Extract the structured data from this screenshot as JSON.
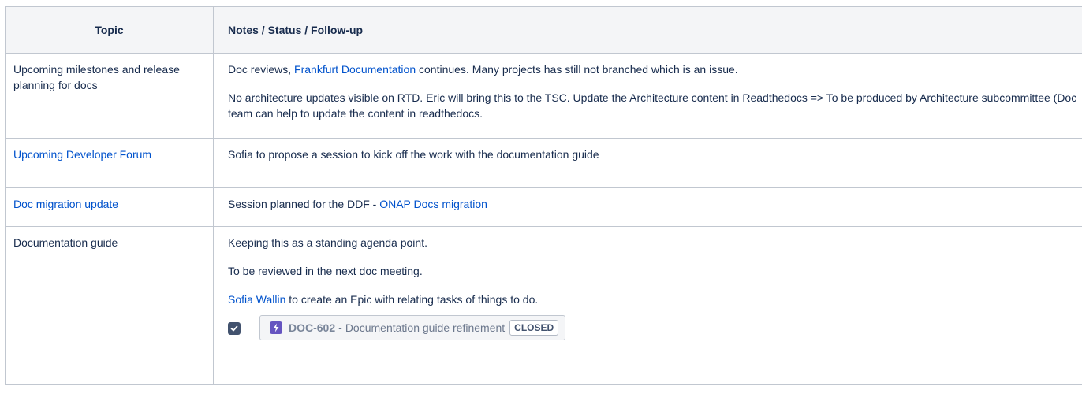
{
  "table": {
    "headers": {
      "topic": "Topic",
      "notes": "Notes / Status / Follow-up"
    },
    "rows": [
      {
        "topic": "Upcoming milestones and release planning for docs",
        "notes_p1_before": "Doc reviews, ",
        "notes_p1_link": "Frankfurt Documentation",
        "notes_p1_after": " continues. Many projects has still not branched which is an issue.",
        "notes_p2": "No architecture updates visible on RTD. Eric will bring this to the TSC. Update the Architecture content in Readthedocs => To be produced by Architecture subcommittee (Doc team can help to update the content in readthedocs."
      },
      {
        "topic_link": "Upcoming Developer Forum",
        "notes_p1": "Sofia to propose a session to kick off the work with the documentation guide"
      },
      {
        "topic_link": "Doc migration update",
        "notes_p1_before": "Session planned for the DDF - ",
        "notes_p1_link": "ONAP Docs migration"
      },
      {
        "topic": "Documentation guide",
        "notes_p1": "Keeping this as a standing agenda point.",
        "notes_p2": "To be reviewed in the next doc meeting.",
        "notes_p3_mention": "Sofia Wallin",
        "notes_p3_after": " to create an Epic with relating tasks of things to do.",
        "task": {
          "checked": true,
          "checkbox_icon": "check-icon",
          "issue_type_icon": "epic-lightning-icon",
          "issue_key": "DOC-602",
          "separator": "-",
          "issue_summary": "Documentation guide refinement",
          "status": "CLOSED"
        }
      }
    ]
  },
  "colors": {
    "link": "#0052cc",
    "header_bg": "#f4f5f7",
    "border": "#c1c7d0",
    "epic": "#6554c0",
    "checkbox": "#42526e"
  }
}
